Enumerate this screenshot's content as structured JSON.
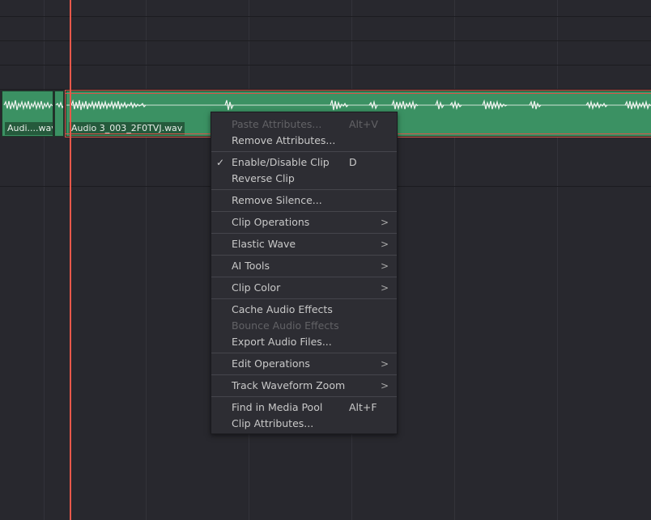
{
  "timeline": {
    "clips": [
      {
        "label": "Audi....wav",
        "selected": false
      },
      {
        "label": "",
        "selected": false
      },
      {
        "label": "Audio 3_003_2F0TVJ.wav",
        "selected": true
      }
    ],
    "colors": {
      "clip": "#3b9163",
      "playhead": "#e8584a",
      "background": "#28282e"
    }
  },
  "context_menu": {
    "items": [
      {
        "label": "Paste Attributes...",
        "shortcut": "Alt+V",
        "enabled": false
      },
      {
        "label": "Remove Attributes...",
        "shortcut": "",
        "enabled": true
      },
      {
        "label": "Enable/Disable Clip",
        "shortcut": "D",
        "checked": true,
        "enabled": true
      },
      {
        "label": "Reverse Clip",
        "shortcut": "",
        "enabled": true
      },
      {
        "label": "Remove Silence...",
        "shortcut": "",
        "enabled": true
      },
      {
        "label": "Clip Operations",
        "submenu": true,
        "enabled": true
      },
      {
        "label": "Elastic Wave",
        "submenu": true,
        "enabled": true
      },
      {
        "label": "AI Tools",
        "submenu": true,
        "enabled": true
      },
      {
        "label": "Clip Color",
        "submenu": true,
        "enabled": true
      },
      {
        "label": "Cache Audio Effects",
        "shortcut": "",
        "enabled": true
      },
      {
        "label": "Bounce Audio Effects",
        "shortcut": "",
        "enabled": false
      },
      {
        "label": "Export Audio Files...",
        "shortcut": "",
        "enabled": true
      },
      {
        "label": "Edit Operations",
        "submenu": true,
        "enabled": true
      },
      {
        "label": "Track Waveform Zoom",
        "submenu": true,
        "enabled": true
      },
      {
        "label": "Find in Media Pool",
        "shortcut": "Alt+F",
        "enabled": true
      },
      {
        "label": "Clip Attributes...",
        "shortcut": "",
        "enabled": true
      }
    ],
    "icons": {
      "check": "checkmark-icon",
      "submenu": "chevron-right-icon"
    }
  }
}
